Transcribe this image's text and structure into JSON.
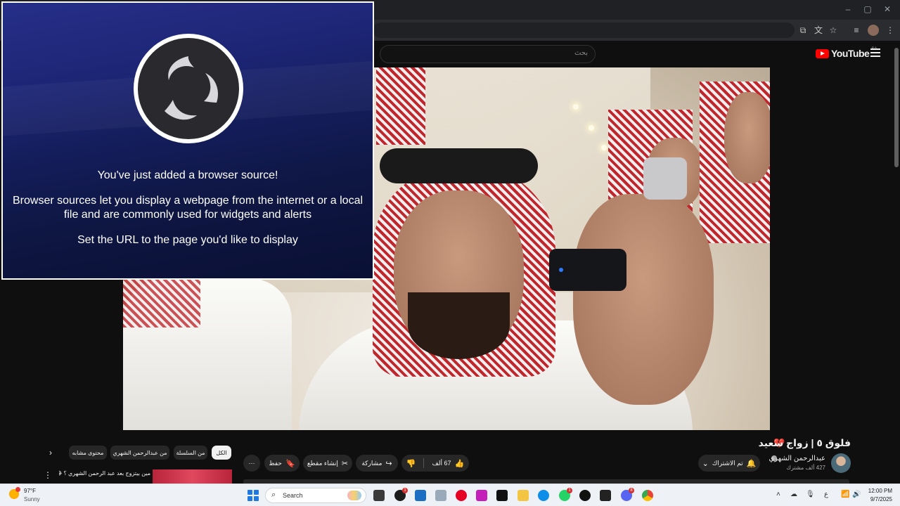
{
  "browser": {
    "window_controls": {
      "minimize": "–",
      "maximize": "▢",
      "close": "✕"
    },
    "toolbar_icons": [
      "cast-icon",
      "translate-icon",
      "star-icon",
      "media-icon",
      "profile-avatar",
      "kebab-menu-icon"
    ]
  },
  "youtube": {
    "search_placeholder": "بحث",
    "logo_text": "YouTube",
    "region": "SA"
  },
  "obs": {
    "heading": "You've just added a browser source!",
    "description": "Browser sources let you display a webpage from the internet or a local file and are commonly used for widgets and alerts",
    "instruction": "Set the URL to the page you'd like to display"
  },
  "video_info": {
    "title": "فلوق ٥ | زواج سعيد",
    "channel_name": "عبدالرحمن الشهري",
    "subscribers": "427 ألف مشترك",
    "subscribed_label": "تم الاشتراك",
    "likes": "67 ألف",
    "share_label": "مشاركة",
    "clip_label": "إنشاء مقطع",
    "save_label": "حفظ",
    "more_label": "···"
  },
  "chips": {
    "all": "الكل",
    "series": "من السلسلة",
    "from_channel": "من عبدالرحمن الشهري",
    "related": "محتوى مشابه",
    "next": "›"
  },
  "recommendation": {
    "title": "مين بيتزوج بعد عبد الرحمن الشهري ؟ 😂",
    "menu": "⋮"
  },
  "taskbar": {
    "temperature": "97°F",
    "condition": "Sunny",
    "search_label": "Search",
    "language": "ع",
    "time": "12:00 PM",
    "date": "9/7/2025",
    "badges": {
      "messenger": "1",
      "whatsapp": "1",
      "discord": "8"
    },
    "colors": {
      "start": "#1f7ae0",
      "pinterest": "#e60023",
      "picsart": "#c51fba",
      "tiktok": "#111111",
      "whatsapp": "#25d366",
      "edge": "#0e8ee9",
      "folder": "#f4c542"
    }
  }
}
